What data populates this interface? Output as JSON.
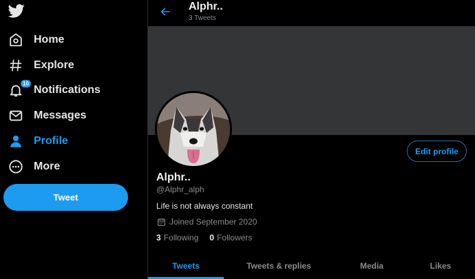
{
  "sidebar": {
    "items": [
      {
        "label": "Home",
        "icon": "home-icon"
      },
      {
        "label": "Explore",
        "icon": "hashtag-icon"
      },
      {
        "label": "Notifications",
        "icon": "bell-icon",
        "badge": "10"
      },
      {
        "label": "Messages",
        "icon": "envelope-icon"
      },
      {
        "label": "Profile",
        "icon": "person-icon"
      },
      {
        "label": "More",
        "icon": "more-circle-icon"
      }
    ],
    "tweet_label": "Tweet"
  },
  "header": {
    "title": "Alphr..",
    "subtitle": "3 Tweets"
  },
  "profile": {
    "display_name": "Alphr..",
    "handle": "@Alphr_alph",
    "bio": "Life is not always constant",
    "joined": "Joined September 2020",
    "following_count": "3",
    "following_label": "Following",
    "followers_count": "0",
    "followers_label": "Followers",
    "edit_label": "Edit profile"
  },
  "tabs": [
    {
      "label": "Tweets"
    },
    {
      "label": "Tweets & replies"
    },
    {
      "label": "Media"
    },
    {
      "label": "Likes"
    }
  ],
  "colors": {
    "accent": "#1d9bf0",
    "background": "#000000",
    "banner": "#333537"
  }
}
